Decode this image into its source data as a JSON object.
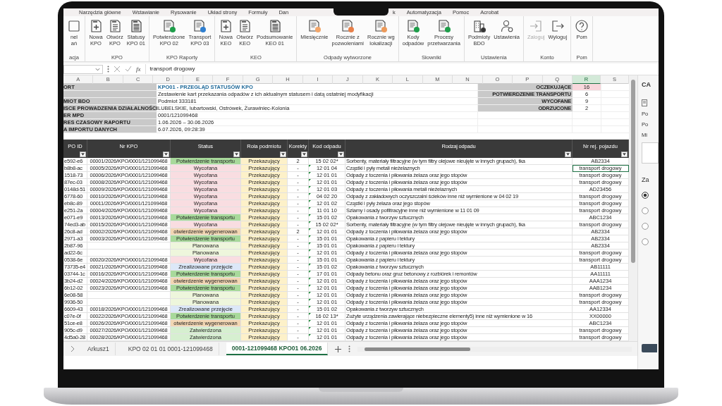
{
  "ribbon_tabs": [
    "Narzędzia główne",
    "Wstawianie",
    "Rysowanie",
    "Układ strony",
    "Formuły",
    "Dan"
  ],
  "ribbon_tabs_after_notch": [
    "k",
    "Automatyzacja",
    "Pomoc",
    "Acrobat"
  ],
  "ribbon_groups": [
    {
      "label": "acja",
      "buttons": [
        {
          "lines": [
            "nel",
            "ań"
          ],
          "kind": "panel",
          "disabled": false
        }
      ]
    },
    {
      "label": "KPO",
      "buttons": [
        {
          "lines": [
            "Nowa",
            "KPO"
          ],
          "kind": "new",
          "disabled": false
        },
        {
          "lines": [
            "Otwórz",
            "KPO"
          ],
          "kind": "doc",
          "disabled": false
        },
        {
          "lines": [
            "Statusy",
            "KPO 01"
          ],
          "kind": "lines",
          "disabled": false
        }
      ]
    },
    {
      "label": "KPO Raporty",
      "buttons": [
        {
          "lines": [
            "Potwierdzone",
            "KPO 02"
          ],
          "kind": "badge",
          "color": "#1e9e4a",
          "disabled": false
        },
        {
          "lines": [
            "Transport",
            "KPO 03"
          ],
          "kind": "badge",
          "color": "#2f7fd0",
          "disabled": false
        }
      ]
    },
    {
      "label": "KEO",
      "buttons": [
        {
          "lines": [
            "Nowa",
            "KEO"
          ],
          "kind": "new",
          "disabled": false
        },
        {
          "lines": [
            "Otwórz",
            "KEO"
          ],
          "kind": "doc",
          "disabled": false
        },
        {
          "lines": [
            "Podsumowanie",
            "KEO 01"
          ],
          "kind": "lines",
          "disabled": false
        }
      ]
    },
    {
      "label": "Odpady wytworzone",
      "buttons": [
        {
          "lines": [
            "Miesięcznie"
          ],
          "kind": "badge",
          "color": "#f2a66a",
          "disabled": false
        },
        {
          "lines": [
            "Rocznie z",
            "pozwoleniami"
          ],
          "kind": "badge",
          "color": "#e8804a",
          "disabled": false
        },
        {
          "lines": [
            "Rocznie wg",
            "lokalizacji"
          ],
          "kind": "badge",
          "color": "#ec9a5a",
          "disabled": false
        }
      ]
    },
    {
      "label": "Słowniki",
      "buttons": [
        {
          "lines": [
            "Kody",
            "odpadów"
          ],
          "kind": "badge",
          "color": "#1e9e4a",
          "disabled": false
        },
        {
          "lines": [
            "Procesy",
            "przetwarzania"
          ],
          "kind": "badge",
          "color": "#1e9e4a",
          "disabled": false
        }
      ]
    },
    {
      "label": "Ustawienia",
      "buttons": [
        {
          "lines": [
            "Podmioty",
            "BDO"
          ],
          "kind": "building",
          "disabled": false
        },
        {
          "lines": [
            "Ustawienia"
          ],
          "kind": "person",
          "disabled": false
        }
      ]
    },
    {
      "label": "Konto",
      "buttons": [
        {
          "lines": [
            "Zaloguj"
          ],
          "kind": "login",
          "disabled": true
        },
        {
          "lines": [
            "Wyloguj"
          ],
          "kind": "logout",
          "disabled": false
        }
      ]
    },
    {
      "label": "Pom",
      "buttons": [
        {
          "lines": [
            "Pom"
          ],
          "kind": "help",
          "disabled": false
        }
      ]
    }
  ],
  "formula_bar": {
    "function_label": "fx",
    "value": "transport drogowy"
  },
  "column_letters": [
    {
      "label": "A",
      "selected": false
    },
    {
      "label": "B",
      "selected": false
    },
    {
      "label": "C",
      "selected": false
    },
    {
      "label": "D",
      "selected": false
    },
    {
      "label": "E",
      "selected": false
    },
    {
      "label": "F",
      "selected": false
    },
    {
      "label": "G",
      "selected": false
    },
    {
      "label": "H",
      "selected": false
    },
    {
      "label": "I",
      "selected": false
    },
    {
      "label": "J",
      "selected": false
    },
    {
      "label": "K",
      "selected": false
    },
    {
      "label": "L",
      "selected": false
    },
    {
      "label": "M",
      "selected": false
    },
    {
      "label": "N",
      "selected": false
    },
    {
      "label": "O",
      "selected": false
    },
    {
      "label": "P",
      "selected": false
    },
    {
      "label": "Q",
      "selected": false
    },
    {
      "label": "R",
      "selected": true
    },
    {
      "label": "S",
      "selected": false
    }
  ],
  "report_info": [
    {
      "label": "ORT",
      "value": "KPO01 -  PRZEGLĄD STATUSÓW KPO",
      "kind": "title"
    },
    {
      "value": "Zestawienie kart przekazania odpadów z ich aktualnym statusem i datą ostatniej modyfikacji",
      "kind": "text"
    },
    {
      "label": "MIOT BDO",
      "value": "Podmiot 333181",
      "kind": "text"
    },
    {
      "label": "ISCE PROWADZENIA DZIAŁALNOŚCI",
      "value": "LUBELSKIE, lubartowski, Ostrówek, Żurawiniec-Kolonia",
      "kind": "text"
    },
    {
      "label": "ER MPD",
      "value": "0001/121099468",
      "kind": "text"
    },
    {
      "label": "RES CZASOWY RAPORTU",
      "value": "1.06.2026 – 30.06.2026",
      "kind": "text"
    },
    {
      "label": "A IMPORTU DANYCH",
      "value": "6.07.2026, 09:28:39",
      "kind": "text"
    }
  ],
  "summary": [
    {
      "label": "OCZEKUJĄCE",
      "value": "16",
      "highlighted": true
    },
    {
      "label": "POTWIERDZENIE TRANSPORTU",
      "value": "6",
      "highlighted": false
    },
    {
      "label": "WYCOFANE",
      "value": "9",
      "highlighted": false
    },
    {
      "label": "ODRZUCONE",
      "value": "2",
      "highlighted": false
    }
  ],
  "table": {
    "columns": [
      "PO ID",
      "Nr KPO",
      "Status",
      "Rola podmiotu",
      "Korekty",
      "Kod odpadu",
      "Rodzaj odpadu",
      "Nr rej. pojazdu"
    ],
    "rows": [
      {
        "id": "e592-e6",
        "nr": "00001/2026/KPO/0001/121099468",
        "status": "Potwierdzenie transportu",
        "color": "#a8d99b",
        "role": "Przekazujący",
        "korekty": "2",
        "kod": "15 02 02*",
        "flagged": false,
        "rodzaj": "Sorbenty, materiały filtracyjne (w tym filtry olejowe nieujęte w innych grupach), tka",
        "nr_rej": "AB2334",
        "selected": false
      },
      {
        "id": "b8b8-ac",
        "nr": "00005/2026/KPO/0001/121099468",
        "status": "Wycofana",
        "color": "#f9dde1",
        "role": "Przekazujący",
        "korekty": "-",
        "kod": "12 01 04",
        "flagged": true,
        "rodzaj": "Cząstki i pyły metali nieżelaznych",
        "nr_rej": "transport drogowy",
        "selected": true
      },
      {
        "id": "1518-73",
        "nr": "00006/2026/KPO/0001/121099468",
        "status": "Wycofana",
        "color": "#f9dde1",
        "role": "Przekazujący",
        "korekty": "-",
        "kod": "12 01 01",
        "flagged": true,
        "rodzaj": "Odpady z toczenia i piłowania żelaza oraz jego stopów",
        "nr_rej": "transport drogowy",
        "selected": false
      },
      {
        "id": "87ec-03",
        "nr": "00008/2026/KPO/0001/121099468",
        "status": "Wycofana",
        "color": "#f9dde1",
        "role": "Przekazujący",
        "korekty": "-",
        "kod": "12 01 01",
        "flagged": true,
        "rodzaj": "Odpady z toczenia i piłowania żelaza oraz jego stopów",
        "nr_rej": "transport drogowy",
        "selected": false
      },
      {
        "id": "0148d-51",
        "nr": "00009/2026/KPO/0001/121099468",
        "status": "Wycofana",
        "color": "#f9dde1",
        "role": "Przekazujący",
        "korekty": "-",
        "kod": "12 01 03",
        "flagged": true,
        "rodzaj": "Odpady z toczenia i piłowania metali nieżelaznych",
        "nr_rej": "AD23456",
        "selected": false
      },
      {
        "id": "6778-60",
        "nr": "00010/2026/KPO/0001/121099468",
        "status": "Wycofana",
        "color": "#f9dde1",
        "role": "Przekazujący",
        "korekty": "-",
        "kod": "04 02 20",
        "flagged": true,
        "rodzaj": "Odpady z zakładowych oczyszczalni ścieków inne niż wymienione w 04 02 19",
        "nr_rej": "transport drogowy",
        "selected": false
      },
      {
        "id": "eb8c-89",
        "nr": "00011/2026/KPO/0001/121099468",
        "status": "Wycofana",
        "color": "#f9dde1",
        "role": "Przekazujący",
        "korekty": "-",
        "kod": "12 01 02",
        "flagged": true,
        "rodzaj": "Cząstki i pyły żelaza oraz jego stopów",
        "nr_rej": "transport drogowy",
        "selected": false
      },
      {
        "id": "e251-2a",
        "nr": "00004/2026/KPO/0001/121099468",
        "status": "Wycofana",
        "color": "#f9dde1",
        "role": "Przekazujący",
        "korekty": "-",
        "kod": "11 01 10",
        "flagged": true,
        "rodzaj": "Szlamy i osady pofiltracyjne inne niż wymienione w 11 01 09",
        "nr_rej": "transport drogowy",
        "selected": false
      },
      {
        "id": "e071-e9",
        "nr": "00013/2026/KPO/0001/121099468",
        "status": "Potwierdzenie transportu",
        "color": "#a8d99b",
        "role": "Przekazujący",
        "korekty": "-",
        "kod": "15 01 02",
        "flagged": true,
        "rodzaj": "Opakowania z tworzyw sztucznych",
        "nr_rej": "ABC1234",
        "selected": false
      },
      {
        "id": "74ed3-ab",
        "nr": "00015/2026/KPO/0001/121099468",
        "status": "Wycofana",
        "color": "#f9dde1",
        "role": "Przekazujący",
        "korekty": "-",
        "kod": "15 02 02*",
        "flagged": true,
        "rodzaj": "Sorbenty, materiały filtracyjne (w tym filtry olejowe nieujęte w innych grupach), tka",
        "nr_rej": "transport drogowy",
        "selected": false
      },
      {
        "id": "26c8-ad",
        "nr": "00002/2026/KPO/0001/121099468",
        "status": "otwierdzenie wygenerowan",
        "color": "#f2d6b3",
        "role": "Przekazujący",
        "korekty": "2",
        "kod": "12 01 01",
        "flagged": true,
        "rodzaj": "Odpady z toczenia i piłowania żelaza oraz jego stopów",
        "nr_rej": "AB2334",
        "selected": false
      },
      {
        "id": "2971-a3",
        "nr": "00003/2026/KPO/0001/121099468",
        "status": "Potwierdzenie transportu",
        "color": "#a8d99b",
        "role": "Przekazujący",
        "korekty": "-",
        "kod": "15 01 01",
        "flagged": true,
        "rodzaj": "Opakowania z papieru i tektury",
        "nr_rej": "AB2334",
        "selected": false
      },
      {
        "id": "2b87-96",
        "status": "Planowana",
        "color": "#eef6dc",
        "role": "Przekazujący",
        "korekty": "-",
        "kod": "15 01 01",
        "flagged": true,
        "rodzaj": "Opakowania z papieru i tektury",
        "nr_rej": "AB2334",
        "selected": false
      },
      {
        "id": "ad22-6c",
        "status": "Planowana",
        "color": "#eef6dc",
        "role": "Przekazujący",
        "korekty": "-",
        "kod": "12 01 01",
        "flagged": true,
        "rodzaj": "Odpady z toczenia i piłowania żelaza oraz jego stopów",
        "nr_rej": "transport drogowy",
        "selected": false
      },
      {
        "id": "0538-6e",
        "nr": "00020/2026/KPO/0001/121099468",
        "status": "Wycofana",
        "color": "#f9dde1",
        "role": "Przekazujący",
        "korekty": "-",
        "kod": "15 01 01",
        "flagged": true,
        "rodzaj": "Opakowania z papieru i tektury",
        "nr_rej": "transport drogowy",
        "selected": false
      },
      {
        "id": "73735-e4",
        "nr": "00021/2026/KPO/0001/121099468",
        "status": "Zrealizowane przejęcie",
        "color": "#dce8f8",
        "role": "Przekazujący",
        "korekty": "-",
        "kod": "15 01 02",
        "flagged": true,
        "rodzaj": "Opakowania z tworzyw sztucznych",
        "nr_rej": "AB11111",
        "selected": false
      },
      {
        "id": "03744-1c",
        "nr": "00016/2026/KPO/0001/121099468",
        "status": "Potwierdzenie transportu",
        "color": "#a8d99b",
        "role": "Przekazujący",
        "korekty": "-",
        "kod": "17 01 01",
        "flagged": true,
        "rodzaj": "Odpady betonu oraz gruz betonowy z rozbiórek i remontów",
        "nr_rej": "AA11111",
        "selected": false
      },
      {
        "id": "3b24-d2",
        "nr": "00024/2026/KPO/0001/121099468",
        "status": "otwierdzenie wygenerowan",
        "color": "#f2d6b3",
        "role": "Przekazujący",
        "korekty": "-",
        "kod": "12 01 01",
        "flagged": true,
        "rodzaj": "Odpady z toczenia i piłowania żelaza oraz jego stopów",
        "nr_rej": "AAA1234",
        "selected": false
      },
      {
        "id": "6b12-02",
        "nr": "00023/2026/KPO/0001/121099468",
        "status": "Potwierdzenie transportu",
        "color": "#a8d99b",
        "role": "Przekazujący",
        "korekty": "-",
        "kod": "12 01 01",
        "flagged": true,
        "rodzaj": "Odpady z toczenia i piłowania żelaza oraz jego stopów",
        "nr_rej": "AAB1234",
        "selected": false
      },
      {
        "id": "6e08-58",
        "status": "Planowana",
        "color": "#eef6dc",
        "role": "Przekazujący",
        "korekty": "-",
        "kod": "12 01 01",
        "flagged": true,
        "rodzaj": "Odpady z toczenia i piłowania żelaza oraz jego stopów",
        "nr_rej": "transport drogowy",
        "selected": false
      },
      {
        "id": "9936-50",
        "status": "Planowana",
        "color": "#eef6dc",
        "role": "Przekazujący",
        "korekty": "-",
        "kod": "12 01 01",
        "flagged": true,
        "rodzaj": "Odpady z toczenia i piłowania żelaza oraz jego stopów",
        "nr_rej": "transport drogowy",
        "selected": false
      },
      {
        "id": "6609-43",
        "nr": "00018/2026/KPO/0001/121099468",
        "status": "Zrealizowane przejęcie",
        "color": "#dce8f8",
        "role": "Przekazujący",
        "korekty": "-",
        "kod": "15 01 02",
        "flagged": true,
        "rodzaj": "Opakowania z tworzyw sztucznych",
        "nr_rej": "AA12334",
        "selected": false
      },
      {
        "id": "c07e-0f",
        "nr": "00022/2026/KPO/0001/121099468",
        "status": "Potwierdzenie transportu",
        "color": "#a8d99b",
        "role": "Przekazujący",
        "korekty": "-",
        "kod": "16 02 13*",
        "flagged": true,
        "rodzaj": "Zużyte urządzenia zawierające niebezpieczne elementy5) inne niż wymienione w 16",
        "nr_rej": "XX00000",
        "selected": false
      },
      {
        "id": "51ce-e8",
        "nr": "00026/2026/KPO/0001/121099468",
        "status": "otwierdzenie wygenerowan",
        "color": "#f2d6b3",
        "role": "Przekazujący",
        "korekty": "-",
        "kod": "12 01 01",
        "flagged": true,
        "rodzaj": "Odpady z toczenia i piłowania żelaza oraz jego stopów",
        "nr_rej": "ABC1234",
        "selected": false
      },
      {
        "id": "905c-d9",
        "nr": "00027/2026/KPO/0001/121099468",
        "status": "Zatwierdzona",
        "color": "#d6efd0",
        "role": "Przekazujący",
        "korekty": "-",
        "kod": "12 01 01",
        "flagged": true,
        "rodzaj": "Odpady z toczenia i piłowania żelaza oraz jego stopów",
        "nr_rej": "transport drogowy",
        "selected": false
      },
      {
        "id": "4d5a0-28",
        "nr": "00028/2026/KPO/0001/121099468",
        "status": "Zatwierdzona",
        "color": "#d6efd0",
        "role": "Przekazujący",
        "korekty": "-",
        "kod": "12 01 01",
        "flagged": true,
        "rodzaj": "Odpady z toczenia i piłowania żelaza oraz jego stopów",
        "nr_rej": "transport drogowy",
        "selected": false
      }
    ]
  },
  "sheet_tabs": [
    {
      "label": "Arkusz1",
      "selected": false
    },
    {
      "label": "KPO 02 01 01 0001-121099468",
      "selected": false
    },
    {
      "label": "0001-121099468 KPO01 06.2026",
      "selected": true
    }
  ],
  "side_panel": {
    "title": "CA",
    "fields": [
      "Po",
      "Po",
      "Mi"
    ],
    "section": "Za",
    "options": [
      {
        "selected": true
      },
      {
        "selected": false
      },
      {
        "selected": false
      },
      {
        "selected": false
      }
    ]
  }
}
